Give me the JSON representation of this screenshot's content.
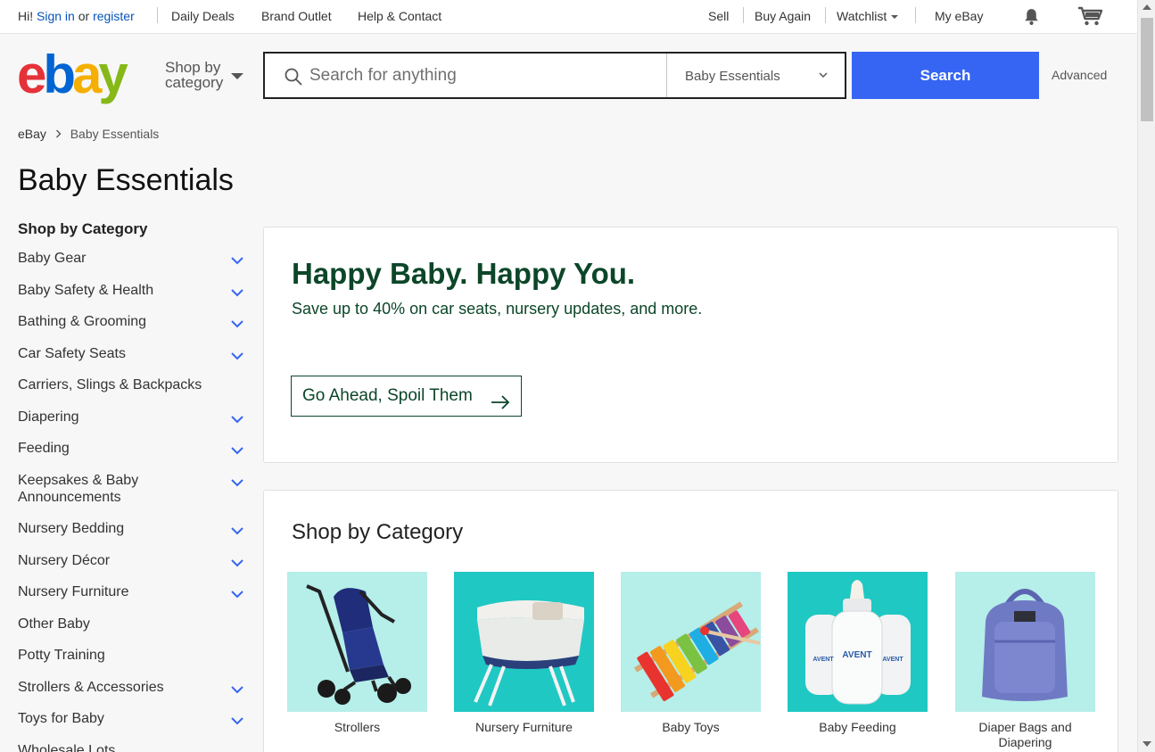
{
  "topbar": {
    "greeting": "Hi!",
    "sign_in": "Sign in",
    "or": "or",
    "register": "register",
    "daily_deals": "Daily Deals",
    "brand_outlet": "Brand Outlet",
    "help_contact": "Help & Contact",
    "sell": "Sell",
    "buy_again": "Buy Again",
    "watchlist": "Watchlist",
    "my_ebay": "My eBay",
    "icons": [
      "bell-icon",
      "cart-icon"
    ]
  },
  "header": {
    "logo_alt": "ebay",
    "shop_by_line1": "Shop by",
    "shop_by_line2": "category",
    "search_placeholder": "Search for anything",
    "category_selected": "Baby Essentials",
    "search_button": "Search",
    "advanced": "Advanced"
  },
  "breadcrumb": {
    "root": "eBay",
    "current": "Baby Essentials"
  },
  "page_title": "Baby Essentials",
  "sidebar": {
    "title": "Shop by Category",
    "items": [
      {
        "label": "Baby Gear",
        "expandable": true
      },
      {
        "label": "Baby Safety & Health",
        "expandable": true
      },
      {
        "label": "Bathing & Grooming",
        "expandable": true
      },
      {
        "label": "Car Safety Seats",
        "expandable": true
      },
      {
        "label": "Carriers, Slings & Backpacks",
        "expandable": false
      },
      {
        "label": "Diapering",
        "expandable": true
      },
      {
        "label": "Feeding",
        "expandable": true
      },
      {
        "label": "Keepsakes & Baby Announcements",
        "expandable": true
      },
      {
        "label": "Nursery Bedding",
        "expandable": true
      },
      {
        "label": "Nursery Décor",
        "expandable": true
      },
      {
        "label": "Nursery Furniture",
        "expandable": true
      },
      {
        "label": "Other Baby",
        "expandable": false
      },
      {
        "label": "Potty Training",
        "expandable": false
      },
      {
        "label": "Strollers & Accessories",
        "expandable": true
      },
      {
        "label": "Toys for Baby",
        "expandable": true
      },
      {
        "label": "Wholesale Lots",
        "expandable": false
      }
    ]
  },
  "hero": {
    "title": "Happy Baby. Happy You.",
    "subtitle": "Save up to 40% on car seats, nursery updates, and more.",
    "cta": "Go Ahead, Spoil Them"
  },
  "category_section": {
    "title": "Shop by Category",
    "tiles": [
      {
        "label": "Strollers",
        "bg": "#b6eee9"
      },
      {
        "label": "Nursery Furniture",
        "bg": "#20c8c3"
      },
      {
        "label": "Baby Toys",
        "bg": "#b6eee9"
      },
      {
        "label": "Baby Feeding",
        "bg": "#20c8c3"
      },
      {
        "label": "Diaper Bags and Diapering",
        "bg": "#b6eee9"
      }
    ]
  },
  "colors": {
    "brand_blue": "#3665f3",
    "hero_green": "#0c4629",
    "link_blue": "#0654ba",
    "chevron_blue": "#3665f3"
  }
}
